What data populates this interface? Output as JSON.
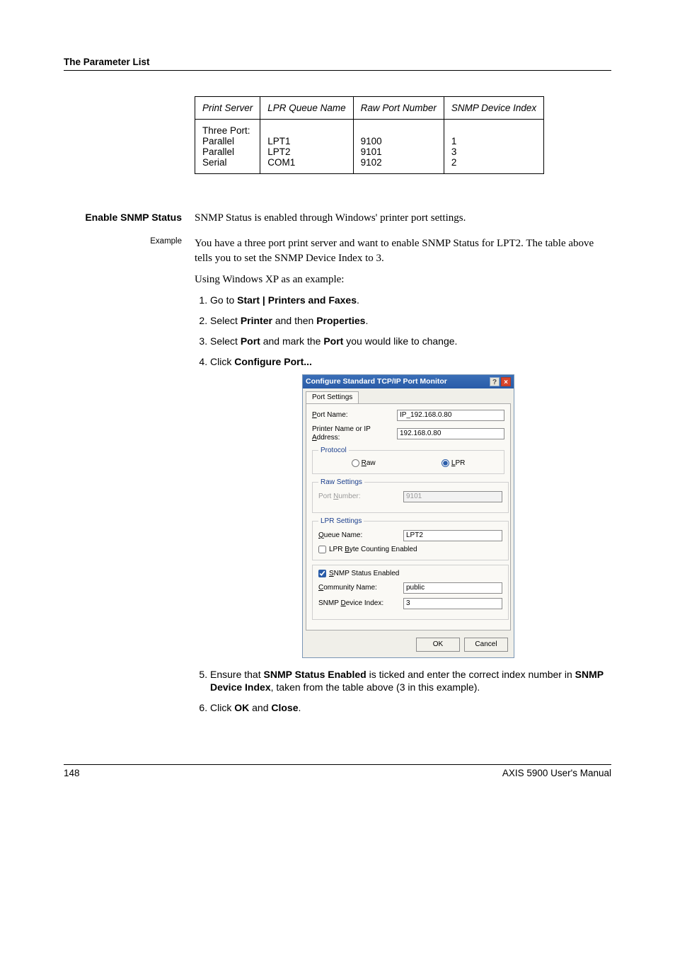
{
  "running_head": "The Parameter List",
  "port_table": {
    "headers": [
      "Print Server",
      "LPR Queue Name",
      "Raw Port Number",
      "SNMP Device Index"
    ],
    "cells": {
      "print_server": "Three Port:\nParallel\nParallel\nSerial",
      "lpr": "\nLPT1\nLPT2\nCOM1",
      "raw": "\n9100\n9101\n9102",
      "snmp": "\n1\n3\n2"
    }
  },
  "enable_heading": "Enable SNMP Status",
  "enable_intro": "SNMP Status is enabled through Windows' printer port settings.",
  "example_label": "Example",
  "example_p1": "You have a three port print server and want to enable SNMP Status for LPT2. The table above tells you to set the SNMP Device Index to 3.",
  "example_p2": "Using Windows XP as an example:",
  "steps": {
    "s1_pre": "Go to ",
    "s1_b": "Start | Printers and Faxes",
    "s1_post": ".",
    "s2_pre": "Select ",
    "s2_b1": "Printer",
    "s2_mid": " and then ",
    "s2_b2": "Properties",
    "s2_post": ".",
    "s3_pre": "Select ",
    "s3_b1": "Port",
    "s3_mid": " and mark the ",
    "s3_b2": "Port",
    "s3_post": " you would like to change.",
    "s4_pre": "Click ",
    "s4_b": "Configure Port...",
    "s5_pre": "Ensure that ",
    "s5_b1": "SNMP Status Enabled",
    "s5_mid": " is ticked and enter the correct index number in ",
    "s5_b2": "SNMP Device Index",
    "s5_post": ", taken from the table above (3 in this example).",
    "s6_pre": "Click ",
    "s6_b1": "OK",
    "s6_mid": " and ",
    "s6_b2": "Close",
    "s6_post": "."
  },
  "dialog": {
    "title": "Configure Standard TCP/IP Port Monitor",
    "help_btn": "?",
    "close_btn": "×",
    "tab": "Port Settings",
    "port_name_label": "Port Name:",
    "port_name_value": "IP_192.168.0.80",
    "printer_label": "Printer Name or IP Address:",
    "printer_value": "192.168.0.80",
    "protocol_legend": "Protocol",
    "raw_label": "Raw",
    "lpr_label": "LPR",
    "raw_settings_legend": "Raw Settings",
    "port_number_label": "Port Number:",
    "port_number_value": "9101",
    "lpr_settings_legend": "LPR Settings",
    "queue_name_label": "Queue Name:",
    "queue_name_value": "LPT2",
    "lpr_byte_label": "LPR Byte Counting Enabled",
    "snmp_chk_label": "SNMP Status Enabled",
    "community_label": "Community Name:",
    "community_value": "public",
    "device_index_label": "SNMP Device Index:",
    "device_index_value": "3",
    "ok": "OK",
    "cancel": "Cancel"
  },
  "footer": {
    "page": "148",
    "title": "AXIS 5900 User's Manual"
  }
}
